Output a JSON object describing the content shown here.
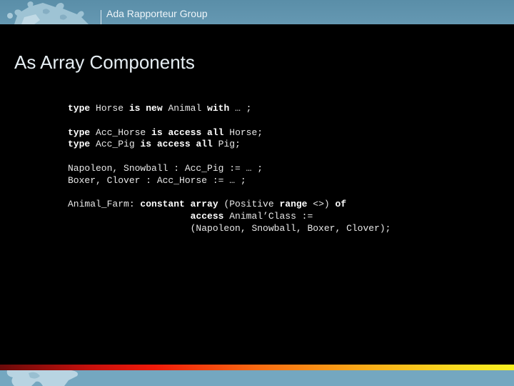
{
  "header": {
    "group_name": "Ada Rapporteur Group",
    "logo_icon": "puzzle-pieces-icon"
  },
  "slide": {
    "title": "As Array Components",
    "code_lines": [
      [
        {
          "t": "type",
          "k": true
        },
        {
          "t": " Horse "
        },
        {
          "t": "is new",
          "k": true
        },
        {
          "t": " Animal "
        },
        {
          "t": "with",
          "k": true
        },
        {
          "t": " … ;"
        }
      ],
      [],
      [
        {
          "t": "type",
          "k": true
        },
        {
          "t": " Acc_Horse "
        },
        {
          "t": "is access all",
          "k": true
        },
        {
          "t": " Horse;"
        }
      ],
      [
        {
          "t": "type",
          "k": true
        },
        {
          "t": " Acc_Pig "
        },
        {
          "t": "is access all",
          "k": true
        },
        {
          "t": " Pig;"
        }
      ],
      [],
      [
        {
          "t": "Napoleon, Snowball : Acc_Pig := … ;"
        }
      ],
      [
        {
          "t": "Boxer, Clover : Acc_Horse := … ;"
        }
      ],
      [],
      [
        {
          "t": "Animal_Farm: "
        },
        {
          "t": "constant array",
          "k": true
        },
        {
          "t": " (Positive "
        },
        {
          "t": "range",
          "k": true
        },
        {
          "t": " <>) "
        },
        {
          "t": "of",
          "k": true
        }
      ],
      [
        {
          "t": "                      "
        },
        {
          "t": "access",
          "k": true
        },
        {
          "t": " Animal’Class :="
        }
      ],
      [
        {
          "t": "                      (Napoleon, Snowball, Boxer, Clover);"
        }
      ]
    ]
  },
  "colors": {
    "header_bg": "#5a8ea8",
    "footer_bg": "#74a7c0",
    "slide_bg": "#000000",
    "accent_bar_start": "#6a0a0a",
    "accent_bar_end": "#f8f020"
  }
}
